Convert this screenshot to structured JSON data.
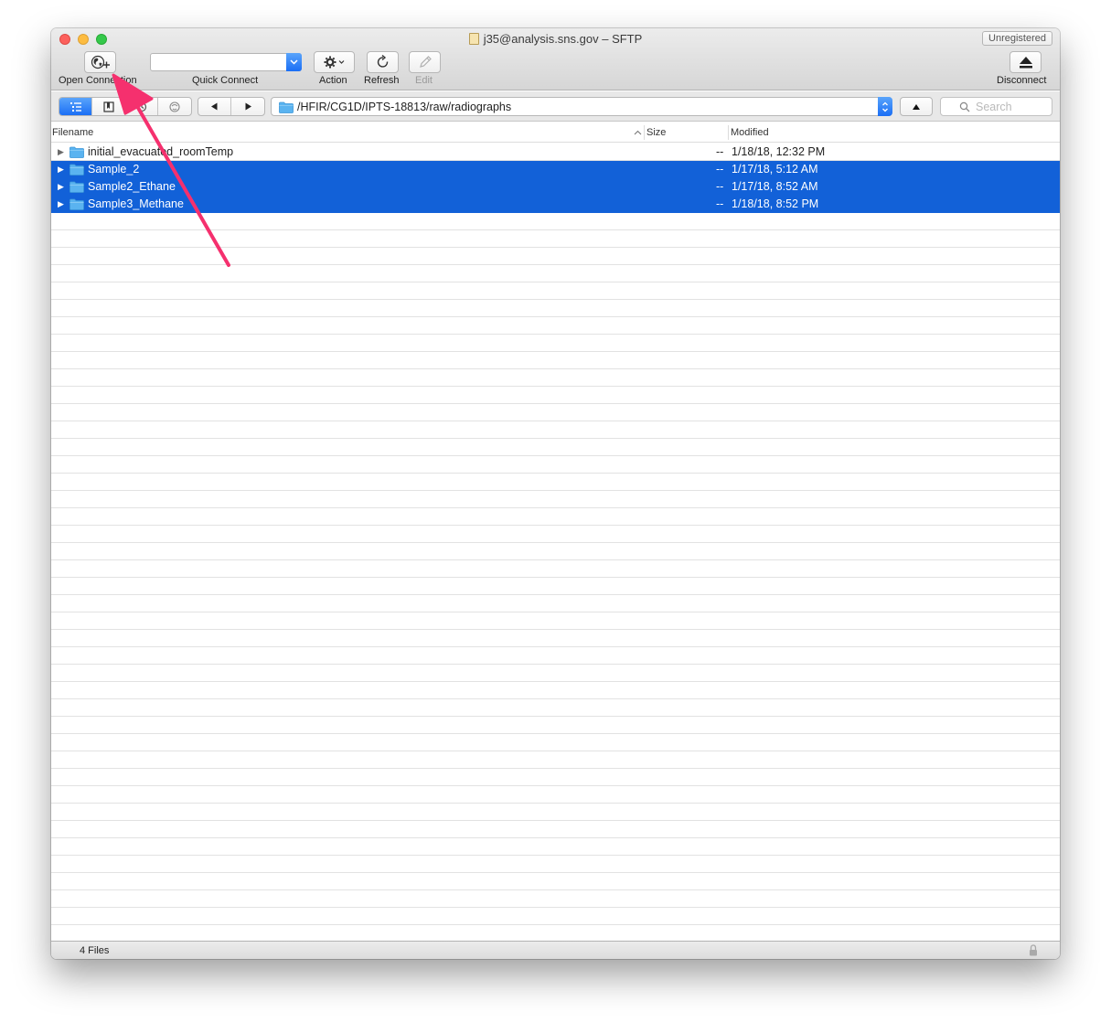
{
  "window": {
    "title": "j35@analysis.sns.gov – SFTP",
    "badge": "Unregistered"
  },
  "toolbar": {
    "open_connection": "Open Connection",
    "quick_connect": "Quick Connect",
    "quick_connect_value": "",
    "action": "Action",
    "refresh": "Refresh",
    "edit": "Edit",
    "disconnect": "Disconnect"
  },
  "navbar": {
    "path": "/HFIR/CG1D/IPTS-18813/raw/radiographs",
    "search_placeholder": "Search"
  },
  "columns": {
    "filename": "Filename",
    "size": "Size",
    "modified": "Modified"
  },
  "files": [
    {
      "name": "initial_evacuated_roomTemp",
      "size": "--",
      "modified": "1/18/18, 12:32 PM",
      "selected": false
    },
    {
      "name": "Sample_2",
      "size": "--",
      "modified": "1/17/18, 5:12 AM",
      "selected": true
    },
    {
      "name": "Sample2_Ethane",
      "size": "--",
      "modified": "1/17/18, 8:52 AM",
      "selected": true
    },
    {
      "name": "Sample3_Methane",
      "size": "--",
      "modified": "1/18/18, 8:52 PM",
      "selected": true
    }
  ],
  "status": {
    "count": "4 Files"
  },
  "colors": {
    "selection": "#1261d8",
    "accent": "#1a6ef5",
    "annotation_arrow": "#f5306e",
    "folder": "#5ab3f0"
  },
  "icons": [
    "globe-plus-icon",
    "chevron-down-icon",
    "gear-icon",
    "refresh-icon",
    "pencil-icon",
    "eject-icon",
    "list-view-icon",
    "bookmark-icon",
    "history-icon",
    "bonjour-icon",
    "back-icon",
    "forward-icon",
    "folder-icon",
    "up-icon",
    "search-icon",
    "lock-icon"
  ]
}
